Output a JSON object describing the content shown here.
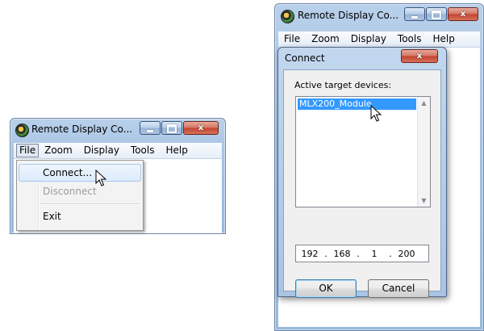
{
  "small_window": {
    "title": "Remote Display Co...",
    "close_label": "x",
    "menu": [
      "File",
      "Zoom",
      "Display",
      "Tools",
      "Help"
    ],
    "file_menu": {
      "connect": "Connect...",
      "disconnect": "Disconnect",
      "exit": "Exit"
    }
  },
  "large_window": {
    "title": "Remote Display Co...",
    "close_label": "x",
    "menu": [
      "File",
      "Zoom",
      "Display",
      "Tools",
      "Help"
    ]
  },
  "connect_dialog": {
    "title": "Connect",
    "close_label": "x",
    "devices_label": "Active target devices:",
    "devices": [
      "MLX200_Module"
    ],
    "ip": [
      "192",
      "168",
      "1",
      "200"
    ],
    "ok_label": "OK",
    "cancel_label": "Cancel"
  },
  "colors": {
    "selection": "#3399ff",
    "close_button": "#c1442f",
    "aero_frame": "#a3c1e3"
  }
}
